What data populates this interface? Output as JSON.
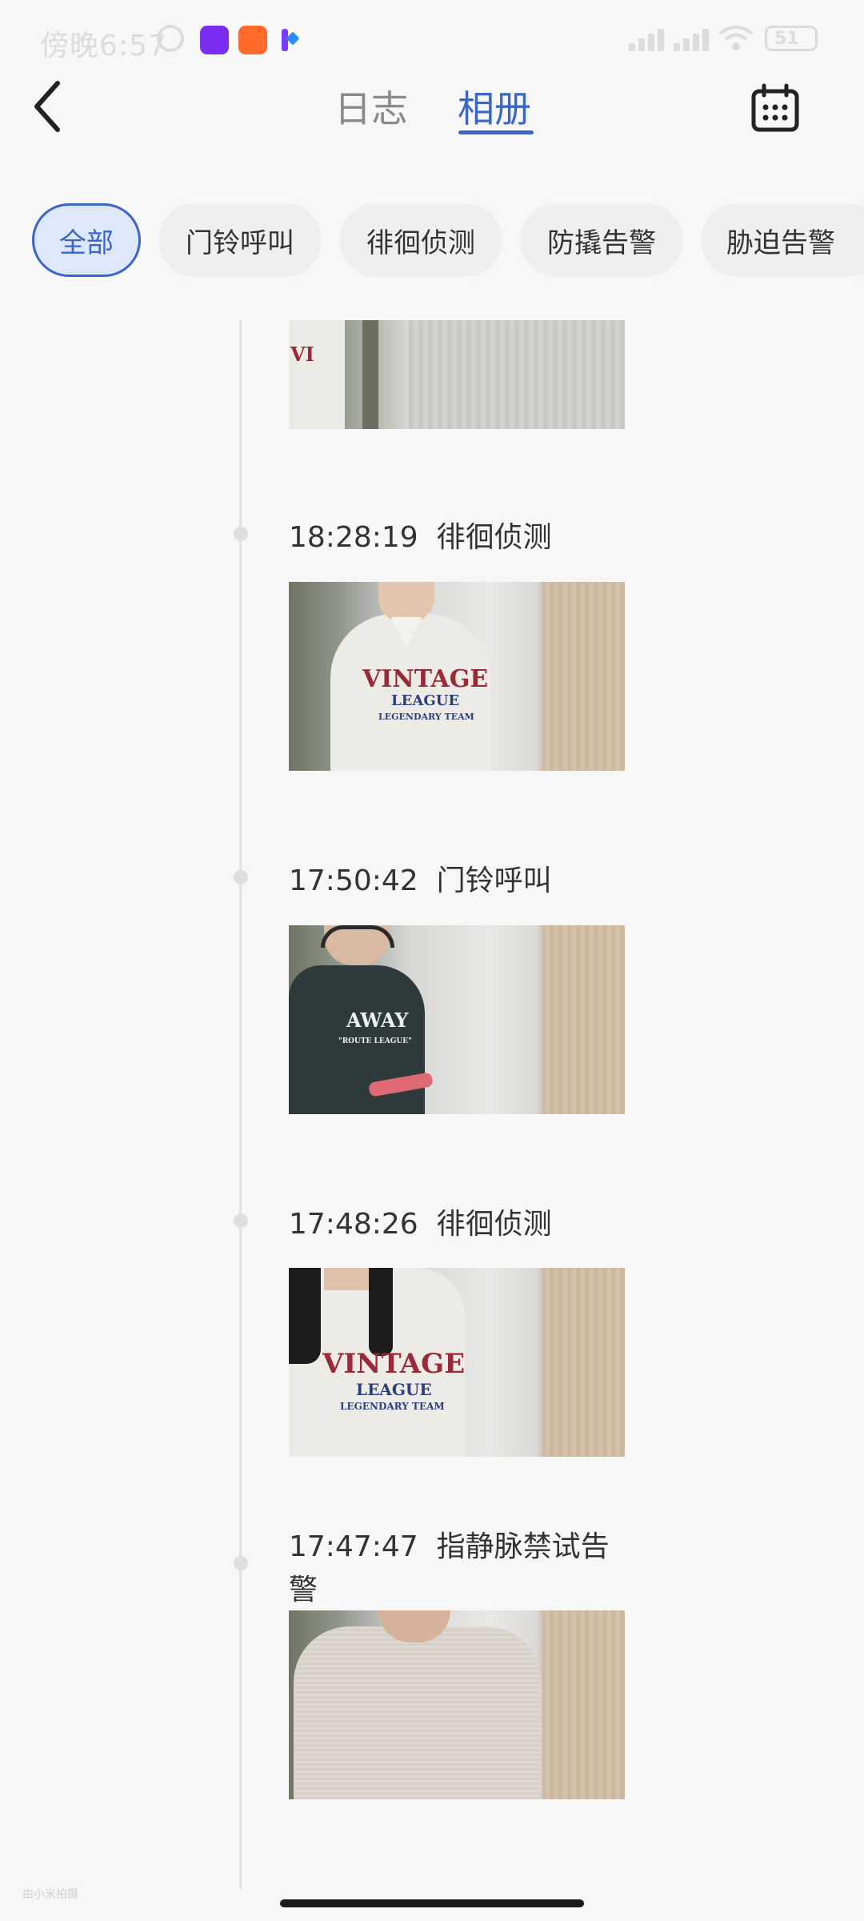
{
  "status_bar": {
    "time": "傍晚6:57",
    "battery": "51"
  },
  "header": {
    "tabs": [
      "日志",
      "相册"
    ],
    "active_tab": "相册",
    "accent_color": "#3a65c9"
  },
  "filters": {
    "items": [
      "全部",
      "门铃呼叫",
      "徘徊侦测",
      "防撬告警",
      "胁迫告警"
    ],
    "selected": "全部"
  },
  "timeline": [
    {
      "time": "",
      "event": "",
      "thumbnail": "person-shirt-partial"
    },
    {
      "time": "18:28:19",
      "event": "徘徊侦测",
      "thumbnail": "person-vintage-shirt"
    },
    {
      "time": "17:50:42",
      "event": "门铃呼叫",
      "thumbnail": "person-helmet-dark-shirt"
    },
    {
      "time": "17:48:26",
      "event": "徘徊侦测",
      "thumbnail": "person-vintage-shirt-long-hair"
    },
    {
      "time": "17:47:47",
      "event": "指静脉禁试告警",
      "thumbnail": "person-knit-top"
    }
  ],
  "footer": {
    "watermark": "由小米拍摄"
  }
}
